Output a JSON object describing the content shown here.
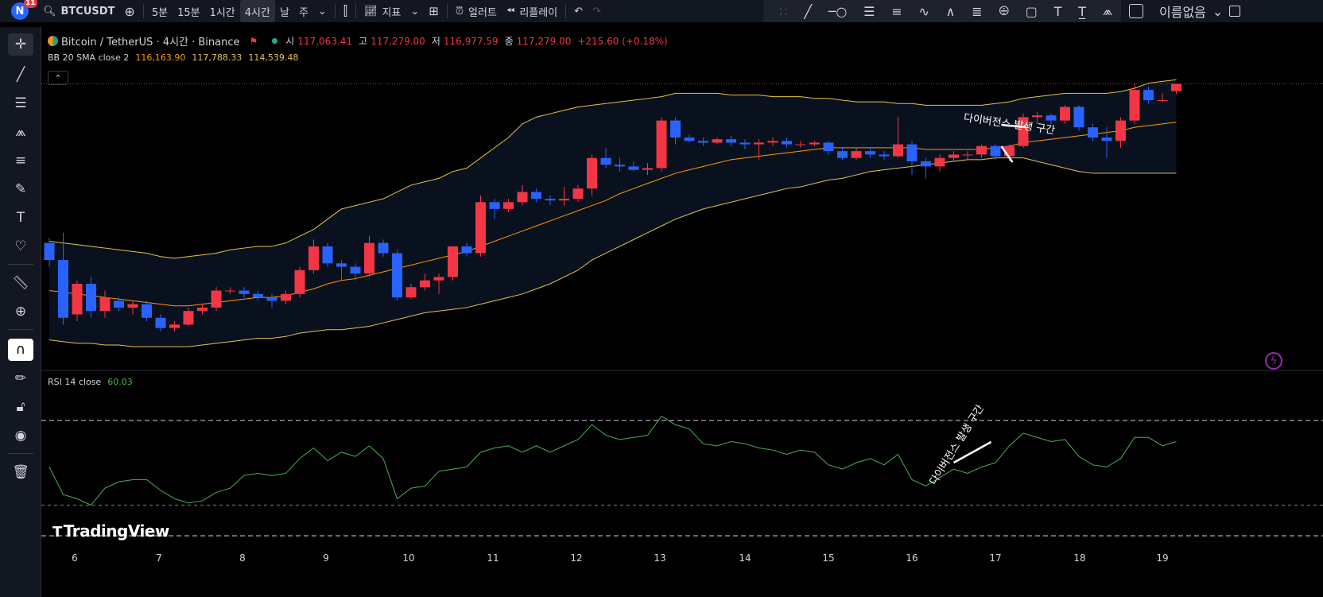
{
  "topbar": {
    "avatar_letter": "N",
    "avatar_badge": "11",
    "symbol": "BTCUSDT",
    "intervals": [
      "5분",
      "15분",
      "1시간",
      "4시간",
      "날",
      "주"
    ],
    "active_interval": "4시간",
    "indicators_label": "지표",
    "alert_label": "얼러트",
    "replay_label": "리플레이",
    "layout_name": "이름없음"
  },
  "legend": {
    "title": "Bitcoin / TetherUS · 4시간 · Binance",
    "open_label": "시",
    "open": "117,063.41",
    "high_label": "고",
    "high": "117,279.00",
    "low_label": "저",
    "low": "116,977.59",
    "close_label": "종",
    "close": "117,279.00",
    "change": "+215.60 (+0.18%)",
    "bb_name": "BB 20 SMA close 2",
    "bb_basis": "116,163.90",
    "bb_upper": "117,788.33",
    "bb_lower": "114,539.48",
    "rsi_name": "RSI 14 close",
    "rsi_value": "60.03"
  },
  "annotations": {
    "price_text": "다이버전스 발생 구간",
    "rsi_text": "다이버전스 발생 구간"
  },
  "brand": "TradingView",
  "colors": {
    "up": "#f23645",
    "down": "#2962ff",
    "bb_basis": "#ff9800",
    "bb_band": "#e7c24d",
    "rsi": "#4caf50",
    "accent": "#2962ff"
  },
  "chart_data": [
    {
      "type": "candlestick",
      "title": "Bitcoin / TetherUS · 4시간 · Binance",
      "x_axis_labels": [
        "6",
        "7",
        "8",
        "9",
        "10",
        "11",
        "12",
        "13",
        "14",
        "15",
        "16",
        "17",
        "18",
        "19"
      ],
      "candles": [
        {
          "o": 112600,
          "c": 112100,
          "h": 112750,
          "l": 111900
        },
        {
          "o": 112100,
          "c": 110400,
          "h": 112900,
          "l": 110200
        },
        {
          "o": 110500,
          "c": 111400,
          "h": 111500,
          "l": 110300
        },
        {
          "o": 111400,
          "c": 110600,
          "h": 111600,
          "l": 110400
        },
        {
          "o": 110600,
          "c": 111000,
          "h": 111200,
          "l": 110400
        },
        {
          "o": 110900,
          "c": 110700,
          "h": 111000,
          "l": 110600
        },
        {
          "o": 110700,
          "c": 110800,
          "h": 110900,
          "l": 110500
        },
        {
          "o": 110800,
          "c": 110400,
          "h": 110900,
          "l": 110300
        },
        {
          "o": 110400,
          "c": 110100,
          "h": 110500,
          "l": 110000
        },
        {
          "o": 110100,
          "c": 110200,
          "h": 110300,
          "l": 110000
        },
        {
          "o": 110200,
          "c": 110600,
          "h": 110700,
          "l": 110150
        },
        {
          "o": 110600,
          "c": 110700,
          "h": 110800,
          "l": 110500
        },
        {
          "o": 110700,
          "c": 111200,
          "h": 111300,
          "l": 110600
        },
        {
          "o": 111200,
          "c": 111200,
          "h": 111300,
          "l": 111100
        },
        {
          "o": 111200,
          "c": 111100,
          "h": 111300,
          "l": 111000
        },
        {
          "o": 111100,
          "c": 111000,
          "h": 111200,
          "l": 110900
        },
        {
          "o": 111000,
          "c": 110900,
          "h": 111100,
          "l": 110700
        },
        {
          "o": 110900,
          "c": 111100,
          "h": 111200,
          "l": 110800
        },
        {
          "o": 111100,
          "c": 111800,
          "h": 111900,
          "l": 111000
        },
        {
          "o": 111800,
          "c": 112500,
          "h": 112700,
          "l": 111700
        },
        {
          "o": 112500,
          "c": 112000,
          "h": 112600,
          "l": 111900
        },
        {
          "o": 112000,
          "c": 111900,
          "h": 112100,
          "l": 111500
        },
        {
          "o": 111900,
          "c": 111700,
          "h": 112000,
          "l": 111500
        },
        {
          "o": 111700,
          "c": 112600,
          "h": 112800,
          "l": 111600
        },
        {
          "o": 112600,
          "c": 112300,
          "h": 112700,
          "l": 112200
        },
        {
          "o": 112300,
          "c": 111000,
          "h": 112400,
          "l": 110900
        },
        {
          "o": 111000,
          "c": 111300,
          "h": 111400,
          "l": 110950
        },
        {
          "o": 111300,
          "c": 111500,
          "h": 111700,
          "l": 111200
        },
        {
          "o": 111500,
          "c": 111600,
          "h": 111700,
          "l": 111100
        },
        {
          "o": 111600,
          "c": 112500,
          "h": 112500,
          "l": 111500
        },
        {
          "o": 112500,
          "c": 112300,
          "h": 112600,
          "l": 112200
        },
        {
          "o": 112300,
          "c": 113800,
          "h": 114000,
          "l": 112200
        },
        {
          "o": 113800,
          "c": 113600,
          "h": 113900,
          "l": 113300
        },
        {
          "o": 113600,
          "c": 113800,
          "h": 113900,
          "l": 113500
        },
        {
          "o": 113800,
          "c": 114100,
          "h": 114300,
          "l": 113700
        },
        {
          "o": 114100,
          "c": 113900,
          "h": 114200,
          "l": 113800
        },
        {
          "o": 113900,
          "c": 113850,
          "h": 114000,
          "l": 113700
        },
        {
          "o": 113850,
          "c": 113900,
          "h": 114250,
          "l": 113700
        },
        {
          "o": 113900,
          "c": 114200,
          "h": 114300,
          "l": 113800
        },
        {
          "o": 114200,
          "c": 115100,
          "h": 115200,
          "l": 114000
        },
        {
          "o": 115100,
          "c": 114900,
          "h": 115400,
          "l": 114800
        },
        {
          "o": 114900,
          "c": 114850,
          "h": 115100,
          "l": 114700
        },
        {
          "o": 114850,
          "c": 114750,
          "h": 115000,
          "l": 114700
        },
        {
          "o": 114750,
          "c": 114800,
          "h": 114950,
          "l": 114600
        },
        {
          "o": 114800,
          "c": 116200,
          "h": 116300,
          "l": 114700
        },
        {
          "o": 116200,
          "c": 115700,
          "h": 116300,
          "l": 115500
        },
        {
          "o": 115700,
          "c": 115600,
          "h": 115800,
          "l": 115550
        },
        {
          "o": 115600,
          "c": 115550,
          "h": 115700,
          "l": 115450
        },
        {
          "o": 115550,
          "c": 115650,
          "h": 115700,
          "l": 115500
        },
        {
          "o": 115650,
          "c": 115550,
          "h": 115750,
          "l": 115450
        },
        {
          "o": 115550,
          "c": 115500,
          "h": 115650,
          "l": 115350
        },
        {
          "o": 115500,
          "c": 115550,
          "h": 115650,
          "l": 115050
        },
        {
          "o": 115550,
          "c": 115600,
          "h": 115700,
          "l": 115450
        },
        {
          "o": 115600,
          "c": 115500,
          "h": 115700,
          "l": 115400
        },
        {
          "o": 115500,
          "c": 115500,
          "h": 115600,
          "l": 115400
        },
        {
          "o": 115500,
          "c": 115550,
          "h": 115600,
          "l": 115450
        },
        {
          "o": 115550,
          "c": 115300,
          "h": 115600,
          "l": 115200
        },
        {
          "o": 115300,
          "c": 115100,
          "h": 115400,
          "l": 115050
        },
        {
          "o": 115100,
          "c": 115300,
          "h": 115400,
          "l": 115050
        },
        {
          "o": 115300,
          "c": 115200,
          "h": 115400,
          "l": 115100
        },
        {
          "o": 115200,
          "c": 115150,
          "h": 115300,
          "l": 115050
        },
        {
          "o": 115150,
          "c": 115500,
          "h": 116300,
          "l": 115100
        },
        {
          "o": 115500,
          "c": 115000,
          "h": 115600,
          "l": 114600
        },
        {
          "o": 115000,
          "c": 114850,
          "h": 115100,
          "l": 114500
        },
        {
          "o": 114850,
          "c": 115100,
          "h": 115200,
          "l": 114700
        },
        {
          "o": 115100,
          "c": 115200,
          "h": 115300,
          "l": 115000
        },
        {
          "o": 115200,
          "c": 115200,
          "h": 115300,
          "l": 115050
        },
        {
          "o": 115200,
          "c": 115450,
          "h": 115500,
          "l": 115100
        },
        {
          "o": 115450,
          "c": 115150,
          "h": 115500,
          "l": 115050
        },
        {
          "o": 115150,
          "c": 115450,
          "h": 115500,
          "l": 115000
        },
        {
          "o": 115450,
          "c": 116300,
          "h": 116400,
          "l": 115400
        },
        {
          "o": 116300,
          "c": 116350,
          "h": 116450,
          "l": 116100
        },
        {
          "o": 116350,
          "c": 116200,
          "h": 116400,
          "l": 116100
        },
        {
          "o": 116200,
          "c": 116600,
          "h": 116650,
          "l": 116100
        },
        {
          "o": 116600,
          "c": 116000,
          "h": 116650,
          "l": 115900
        },
        {
          "o": 116000,
          "c": 115700,
          "h": 116100,
          "l": 115600
        },
        {
          "o": 115700,
          "c": 115600,
          "h": 116000,
          "l": 115100
        },
        {
          "o": 115600,
          "c": 116200,
          "h": 116300,
          "l": 115400
        },
        {
          "o": 116200,
          "c": 117100,
          "h": 117300,
          "l": 116100
        },
        {
          "o": 117100,
          "c": 116800,
          "h": 117200,
          "l": 116700
        },
        {
          "o": 116800,
          "c": 116800,
          "h": 117000,
          "l": 116750
        },
        {
          "o": 117063.41,
          "c": 117279.0,
          "h": 117279.0,
          "l": 116977.59
        }
      ],
      "bb_upper": [
        112650,
        112600,
        112550,
        112500,
        112450,
        112400,
        112350,
        112300,
        112200,
        112150,
        112200,
        112250,
        112300,
        112400,
        112450,
        112500,
        112500,
        112600,
        112800,
        113000,
        113300,
        113600,
        113700,
        113800,
        113900,
        114100,
        114300,
        114400,
        114500,
        114700,
        114800,
        115100,
        115400,
        115700,
        116100,
        116300,
        116400,
        116500,
        116600,
        116650,
        116700,
        116750,
        116800,
        116850,
        116900,
        117000,
        117000,
        117000,
        117000,
        116950,
        116950,
        116950,
        116900,
        116900,
        116900,
        116850,
        116850,
        116800,
        116750,
        116750,
        116750,
        116700,
        116700,
        116650,
        116650,
        116650,
        116650,
        116650,
        116700,
        116750,
        116850,
        116900,
        116950,
        117000,
        117000,
        117000,
        117000,
        117050,
        117150,
        117300,
        117350,
        117400
      ],
      "bb_basis": [
        111200,
        111150,
        111100,
        111050,
        111000,
        110950,
        110900,
        110850,
        110800,
        110750,
        110750,
        110800,
        110850,
        110900,
        110950,
        111000,
        111000,
        111050,
        111150,
        111250,
        111400,
        111500,
        111550,
        111650,
        111750,
        111850,
        111950,
        112050,
        112150,
        112250,
        112350,
        112500,
        112650,
        112800,
        112950,
        113100,
        113250,
        113400,
        113550,
        113700,
        113850,
        114050,
        114200,
        114350,
        114500,
        114650,
        114750,
        114850,
        114950,
        115050,
        115100,
        115150,
        115200,
        115250,
        115300,
        115350,
        115400,
        115400,
        115400,
        115400,
        115400,
        115400,
        115400,
        115350,
        115350,
        115350,
        115350,
        115350,
        115400,
        115450,
        115550,
        115600,
        115650,
        115700,
        115750,
        115800,
        115850,
        115900,
        116000,
        116050,
        116100,
        116150
      ],
      "bb_lower": [
        109750,
        109700,
        109650,
        109650,
        109600,
        109600,
        109550,
        109550,
        109550,
        109550,
        109550,
        109600,
        109650,
        109700,
        109750,
        109800,
        109800,
        109850,
        109950,
        110000,
        110050,
        110050,
        110100,
        110150,
        110250,
        110350,
        110450,
        110550,
        110600,
        110650,
        110700,
        110800,
        110900,
        111000,
        111100,
        111250,
        111400,
        111600,
        111800,
        112100,
        112300,
        112500,
        112700,
        112900,
        113100,
        113300,
        113450,
        113600,
        113700,
        113800,
        113900,
        114000,
        114100,
        114200,
        114250,
        114350,
        114450,
        114500,
        114600,
        114700,
        114750,
        114800,
        114850,
        114900,
        114950,
        115000,
        115050,
        115050,
        115100,
        115100,
        115100,
        115000,
        114900,
        114800,
        114700,
        114650,
        114650,
        114650,
        114650,
        114650,
        114650,
        114650
      ]
    },
    {
      "type": "line",
      "title": "RSI 14 close",
      "ylim": [
        20,
        85
      ],
      "levels": [
        70,
        30
      ],
      "values": [
        48,
        35,
        33,
        30,
        38,
        41,
        42,
        42,
        37,
        33,
        31,
        32,
        36,
        38,
        44,
        45,
        44,
        45,
        52,
        57,
        51,
        55,
        53,
        58,
        52,
        33,
        38,
        39,
        46,
        47,
        48,
        55,
        57,
        58,
        55,
        58,
        55,
        58,
        61,
        68,
        63,
        61,
        62,
        63,
        72,
        68,
        66,
        59,
        58,
        60,
        59,
        57,
        56,
        54,
        56,
        55,
        49,
        47,
        50,
        52,
        49,
        54,
        42,
        39,
        43,
        47,
        45,
        48,
        50,
        58,
        64,
        62,
        60,
        61,
        53,
        49,
        48,
        52,
        62,
        62,
        58,
        60
      ]
    }
  ]
}
